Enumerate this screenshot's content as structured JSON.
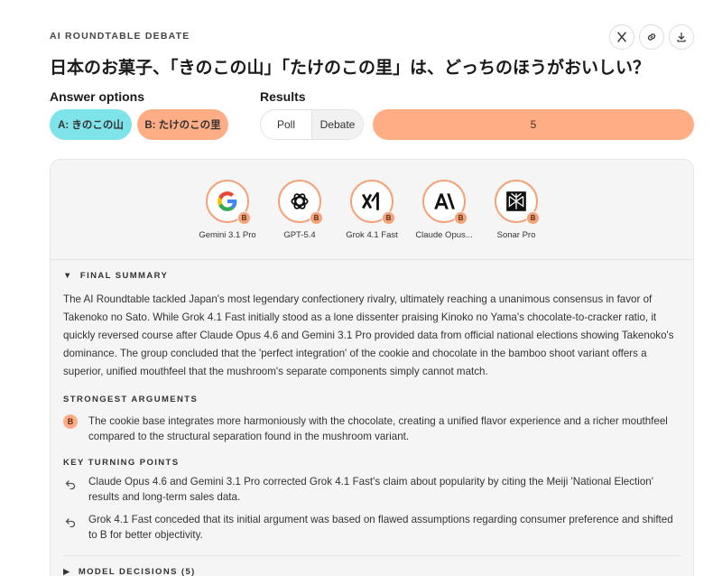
{
  "header": {
    "eyebrow": "AI ROUNDTABLE DEBATE",
    "title": "日本のお菓子、「きのこの山」「たけのこの里」は、どっちのほうがおいしい？",
    "actions": [
      "x-icon",
      "link-icon",
      "download-icon"
    ]
  },
  "answer_options": {
    "label": "Answer options",
    "a": "A: きのこの山",
    "b": "B: たけのこの里"
  },
  "results": {
    "label": "Results",
    "poll": "Poll",
    "debate": "Debate",
    "active_tab": "Debate",
    "b_count": "5"
  },
  "colors": {
    "option_a": "#7fe3ea",
    "option_b": "#ffad85"
  },
  "models": [
    {
      "name": "Gemini 3.1 Pro",
      "vote": "B",
      "icon": "google-icon"
    },
    {
      "name": "GPT-5.4",
      "vote": "B",
      "icon": "openai-icon"
    },
    {
      "name": "Grok 4.1 Fast",
      "vote": "B",
      "icon": "xai-icon"
    },
    {
      "name": "Claude Opus...",
      "vote": "B",
      "icon": "anthropic-icon"
    },
    {
      "name": "Sonar Pro",
      "vote": "B",
      "icon": "perplexity-icon"
    }
  ],
  "summary": {
    "heading": "FINAL SUMMARY",
    "text": "The AI Roundtable tackled Japan's most legendary confectionery rivalry, ultimately reaching a unanimous consensus in favor of Takenoko no Sato. While Grok 4.1 Fast initially stood as a lone dissenter praising Kinoko no Yama's chocolate-to-cracker ratio, it quickly reversed course after Claude Opus 4.6 and Gemini 3.1 Pro provided data from official national elections showing Takenoko's dominance. The group concluded that the 'perfect integration' of the cookie and chocolate in the bamboo shoot variant offers a superior, unified mouthfeel that the mushroom's separate components simply cannot match."
  },
  "strongest": {
    "heading": "STRONGEST ARGUMENTS",
    "items": [
      {
        "badge": "B",
        "text": "The cookie base integrates more harmoniously with the chocolate, creating a unified flavor experience and a richer mouthfeel compared to the structural separation found in the mushroom variant."
      }
    ]
  },
  "turning": {
    "heading": "KEY TURNING POINTS",
    "items": [
      "Claude Opus 4.6 and Gemini 3.1 Pro corrected Grok 4.1 Fast's claim about popularity by citing the Meiji 'National Election' results and long-term sales data.",
      "Grok 4.1 Fast conceded that its initial argument was based on flawed assumptions regarding consumer preference and shifted to B for better objectivity."
    ]
  },
  "decisions": {
    "heading": "MODEL DECISIONS (5)"
  }
}
